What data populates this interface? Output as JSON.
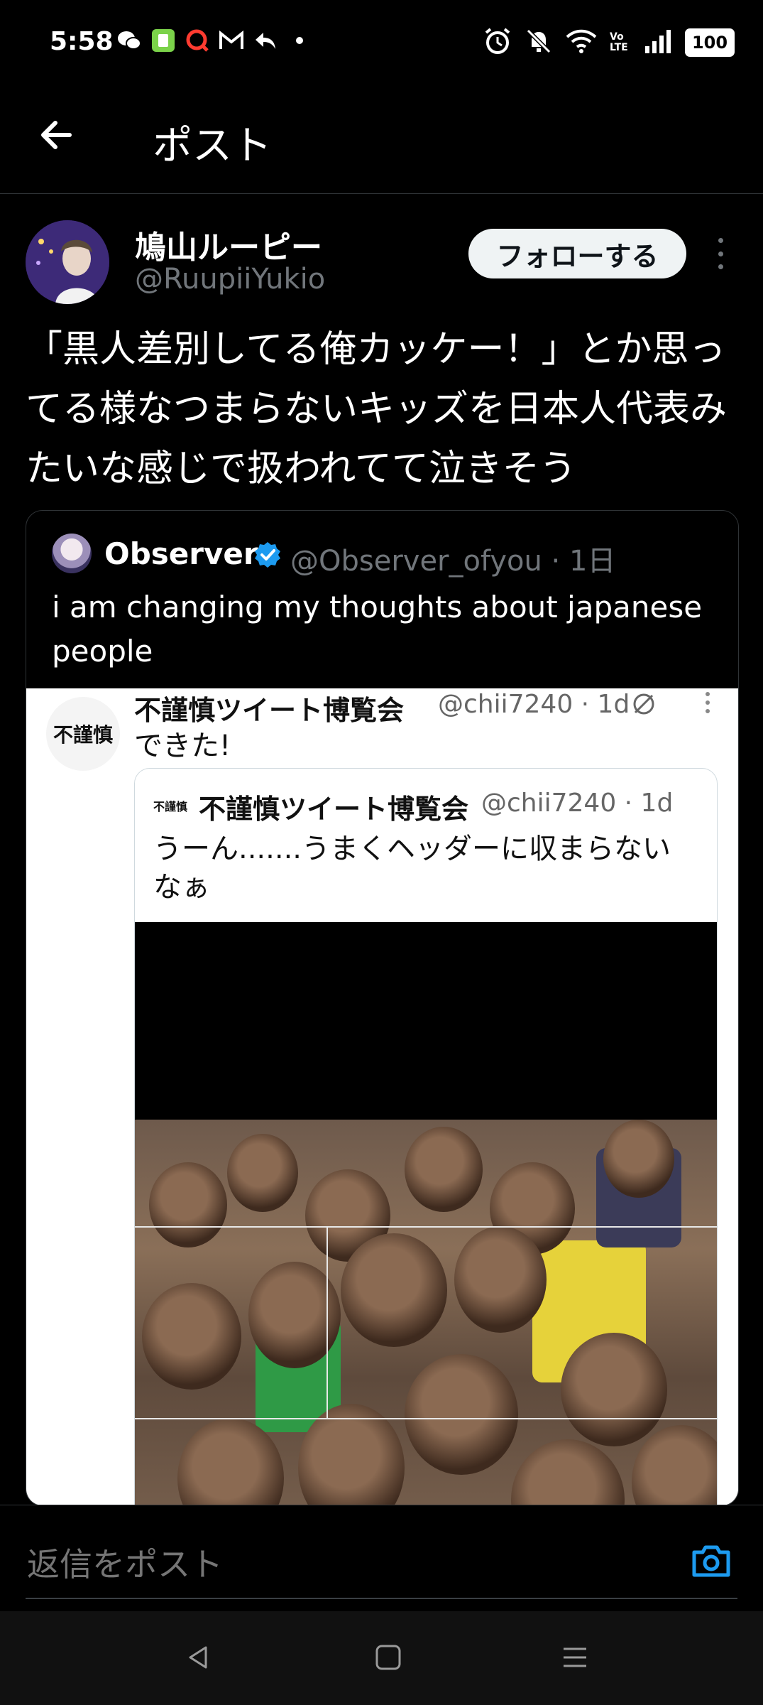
{
  "status": {
    "time": "5:58",
    "battery": "100",
    "volte": "Vo LTE"
  },
  "header": {
    "title": "ポスト"
  },
  "post": {
    "display_name": "鳩山ルーピー",
    "handle": "@RuupiiYukio",
    "follow_label": "フォローする",
    "text": "「黒人差別してる俺カッケー！」とか思ってる様なつまらないキッズを日本人代表みたいな感じで扱われてて泣きそう"
  },
  "quote": {
    "display_name": "Observer",
    "handle_meta": "@Observer_ofyou · 1日",
    "text": "i am changing my thoughts about japanese people",
    "screenshot": {
      "avatar_text": "不謹慎",
      "name": "不謹慎ツイート博覧会",
      "handle_meta": "@chii7240 · 1d",
      "text": "できた!",
      "inner": {
        "avatar_text": "不謹慎",
        "name": "不謹慎ツイート博覧会",
        "handle_meta": "@chii7240 · 1d",
        "text": "うーん.......うまくヘッダーに収まらないなぁ"
      }
    }
  },
  "reply": {
    "placeholder": "返信をポスト"
  },
  "colors": {
    "background": "#000000",
    "text": "#e7e9ea",
    "secondary": "#71767b",
    "accent": "#1d9bf0",
    "follow_bg": "#eff3f4"
  },
  "icons": {
    "back": "arrow-left-icon",
    "more": "more-vertical-icon",
    "verified": "verified-badge-icon",
    "camera": "camera-icon",
    "nav_back": "nav-back-icon",
    "nav_home": "nav-home-icon",
    "nav_recents": "nav-menu-icon"
  }
}
